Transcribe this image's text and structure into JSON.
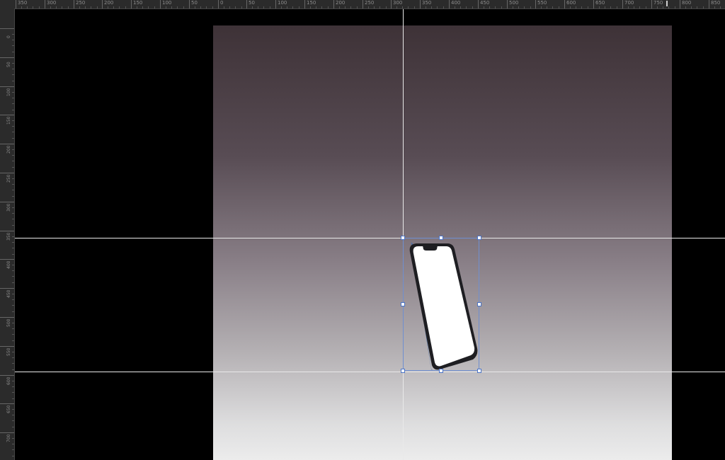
{
  "rulers": {
    "horizontal_labels": [
      "350",
      "300",
      "250",
      "200",
      "150",
      "100",
      "50",
      "0",
      "50",
      "100",
      "150",
      "200",
      "250",
      "300",
      "350",
      "400",
      "450",
      "500",
      "550",
      "600",
      "650",
      "700",
      "750",
      "800",
      "850"
    ],
    "vertical_labels": [
      "0",
      "50",
      "100",
      "150",
      "200",
      "250",
      "300",
      "350",
      "400",
      "450",
      "500",
      "550",
      "600",
      "650",
      "700",
      "750"
    ]
  },
  "artboard": {
    "gradient_top": "#3e3237",
    "gradient_bottom": "#ececec"
  },
  "guides": {
    "color": "#e9e9e9",
    "horizontal_count": 2,
    "vertical_count": 1
  },
  "selection": {
    "border_color": "#6f8fd0",
    "handle_color": "#4b73c4"
  },
  "phone": {
    "frame_color": "#1e1e22",
    "edge_color": "#6b8fc4",
    "screen_color": "#ffffff"
  }
}
